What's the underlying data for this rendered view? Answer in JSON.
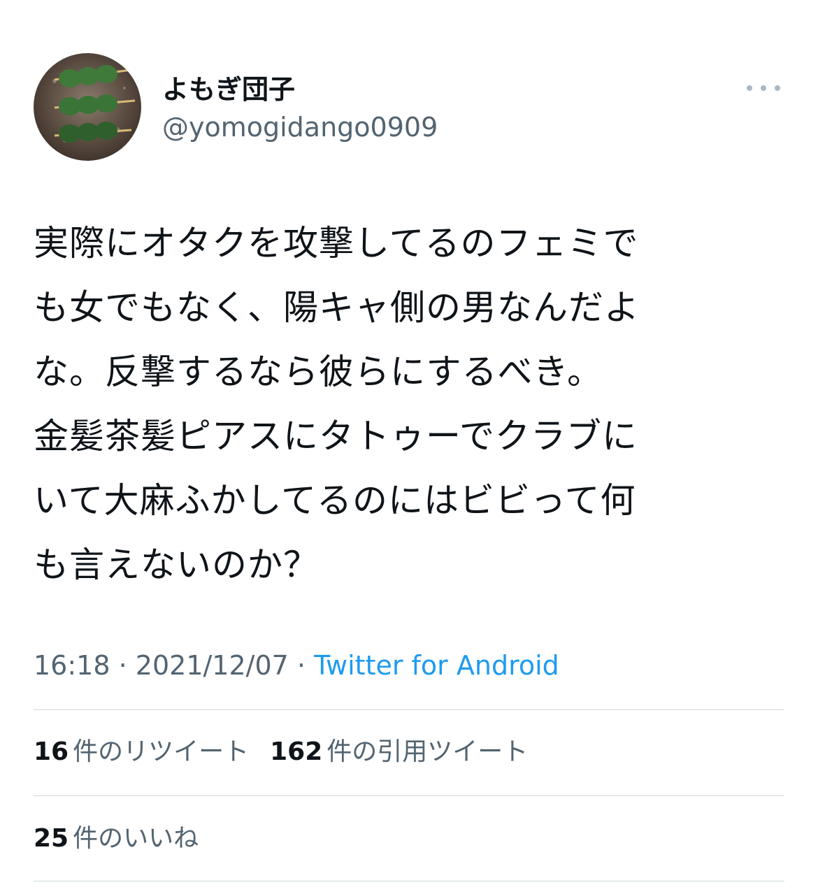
{
  "tweet": {
    "author": {
      "display_name": "よもぎ団子",
      "handle": "@yomogidango0909",
      "avatar_icon": "avatar-dango-image"
    },
    "more_icon": "more-horizontal-icon",
    "text": "実際にオタクを攻撃してるのフェミで\nも女でもなく、陽キャ側の男なんだよ\nな。反撃するなら彼らにするべき。\n金髪茶髪ピアスにタトゥーでクラブに\nいて大麻ふかしてるのにはビビって何\nも言えないのか？",
    "time": "16:18",
    "separator": "·",
    "date": "2021/12/07",
    "source": "Twitter for Android"
  },
  "stats": {
    "retweets": {
      "count": "16",
      "label": "件のリツイート"
    },
    "quotes": {
      "count": "162",
      "label": "件の引用ツイート"
    },
    "likes": {
      "count": "25",
      "label": "件のいいね"
    }
  },
  "colors": {
    "text": "#0f1419",
    "secondary": "#536471",
    "link": "#1d9bf0",
    "divider": "#cfd9de"
  }
}
